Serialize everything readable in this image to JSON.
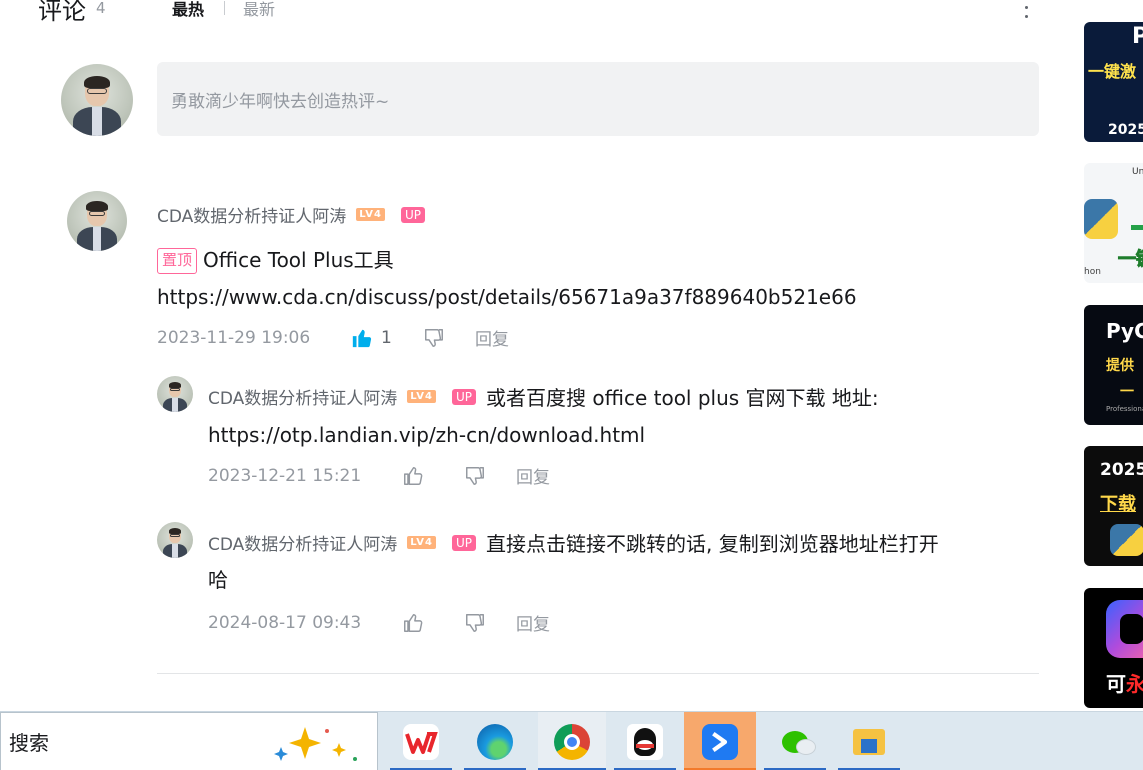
{
  "header": {
    "title": "评论",
    "count": "4",
    "sort_hot": "最热",
    "sort_new": "最新"
  },
  "reply_box": {
    "placeholder": "勇敢滴少年啊快去创造热评~"
  },
  "comments": [
    {
      "user": "CDA数据分析持证人阿涛",
      "level_badge": "LV4",
      "up_badge": "UP",
      "pin_label": "置顶",
      "line1": "Office Tool Plus工具",
      "line2": "https://www.cda.cn/discuss/post/details/65671a9a37f889640b521e66",
      "time": "2023-11-29 19:06",
      "likes": "1",
      "reply_label": "回复",
      "replies": [
        {
          "user": "CDA数据分析持证人阿涛",
          "level_badge": "LV4",
          "up_badge": "UP",
          "line1": "或者百度搜 office tool plus 官网下载 地址:",
          "line2": "https://otp.landian.vip/zh-cn/download.html",
          "time": "2023-12-21 15:21",
          "reply_label": "回复"
        },
        {
          "user": "CDA数据分析持证人阿涛",
          "level_badge": "LV4",
          "up_badge": "UP",
          "line1": "直接点击链接不跳转的话, 复制到浏览器地址栏打开",
          "line2": "哈",
          "time": "2024-08-17 09:43",
          "reply_label": "回复"
        }
      ]
    }
  ],
  "sidebar": {
    "thumbs": [
      {
        "t1": "P",
        "t2": "一键激",
        "t3": "2025"
      },
      {
        "t1": "Un",
        "t2": "一键",
        "t3": "hon"
      },
      {
        "t1": "PyC",
        "t2": "提供",
        "t3": "一",
        "t4": "Professional"
      },
      {
        "t1": "2025",
        "t2": "下载"
      },
      {
        "t1a": "可",
        "t1b": "永"
      }
    ]
  },
  "taskbar": {
    "search_label": "搜索",
    "apps": [
      "wps-icon",
      "edge-icon",
      "chrome-icon",
      "qq-icon",
      "feishu-icon",
      "wechat-icon",
      "explorer-icon"
    ],
    "colors": {
      "active_bg": "#f7a86c",
      "underline": "#2c6ac4"
    }
  },
  "colors": {
    "accent_pink": "#ff6699",
    "like_blue": "#00aeec",
    "level_orange": "#ffb27a"
  }
}
